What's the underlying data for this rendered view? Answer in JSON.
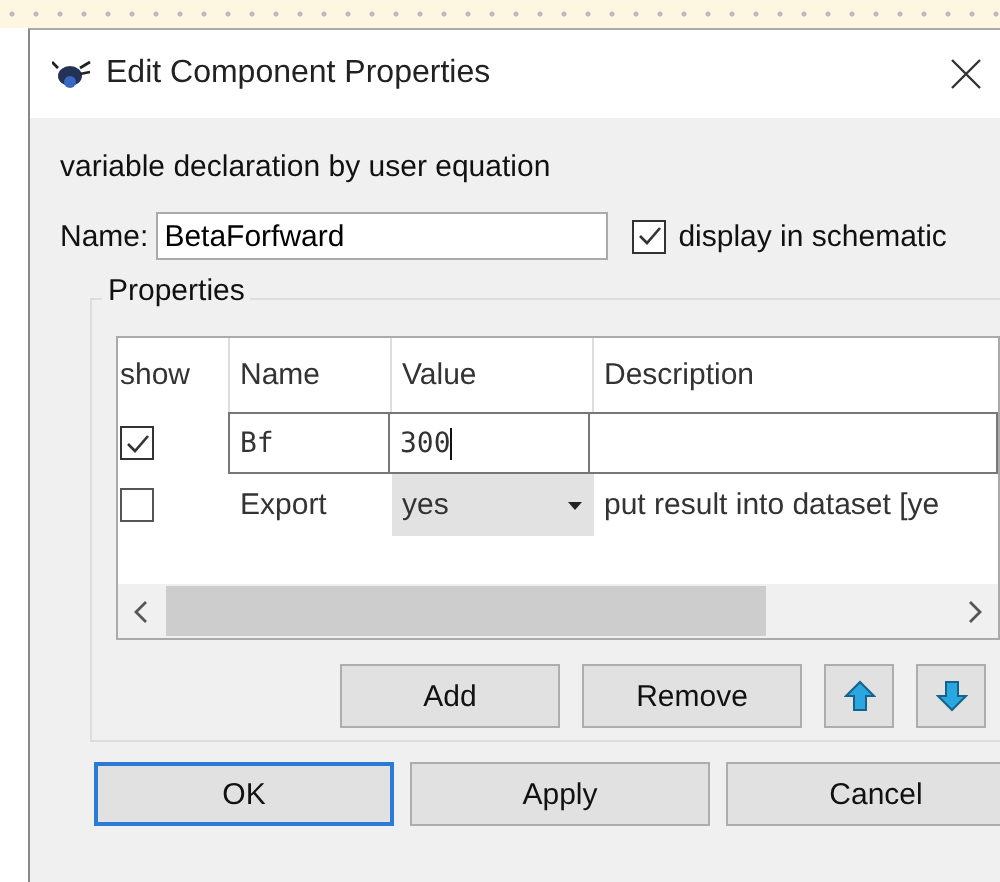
{
  "window": {
    "title": "Edit Component Properties"
  },
  "description": "variable declaration by user equation",
  "name_field": {
    "label": "Name:",
    "value": "BetaForfward"
  },
  "display_in_schematic": {
    "label": "display in schematic",
    "checked": true
  },
  "properties": {
    "title": "Properties",
    "columns": [
      "show",
      "Name",
      "Value",
      "Description"
    ],
    "rows": [
      {
        "show": true,
        "name": "Bf",
        "value": "300",
        "kind": "text",
        "description": ""
      },
      {
        "show": false,
        "name": "Export",
        "value": "yes",
        "kind": "dropdown",
        "description": "put result into dataset [ye"
      }
    ],
    "buttons": [
      "Add",
      "Remove"
    ]
  },
  "footer_buttons": [
    {
      "label": "OK",
      "selected": true
    },
    {
      "label": "Apply",
      "selected": false
    },
    {
      "label": "Cancel",
      "selected": false
    }
  ]
}
